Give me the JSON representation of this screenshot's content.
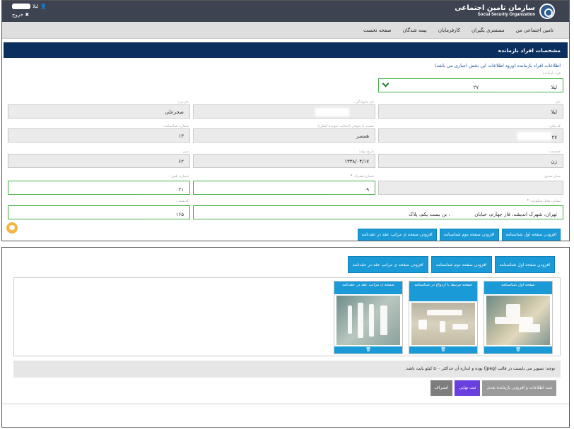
{
  "header": {
    "logo_fa": "سازمان تامین اجتماعی",
    "logo_en": "Social Security Organization",
    "user_name": "لیلا",
    "logout": "خروج",
    "user_icon": "user-icon",
    "logout_icon": "close-icon"
  },
  "menu": {
    "items": [
      "صفحه نخست",
      "بیمه شدگان",
      "کارفرمایان",
      "مستمری بگیران",
      "تامین اجتماعی من"
    ]
  },
  "section": {
    "title": "مشخصات افراد بازمانده",
    "info": "اطلاعات افراد بازمانده (ورود اطلاعات این بخش اجباری می باشد)"
  },
  "form": {
    "person_label": "فرد بازمانده",
    "person_value_name": "لیلا",
    "person_value_code": "۲۷",
    "first_name_label": "نام:",
    "first_name": "لیلا",
    "last_name_label": "نام خانوادگی:",
    "father_label": "نام پدر:",
    "father": "صحرعلی",
    "national_code_label": "کد ملی:",
    "national_code": "۲۷",
    "relation_label": "نسبت با متوفی (حمایت شونده اصلی):",
    "relation": "همسر",
    "id_number_label": "شماره شناسنامه:",
    "id_number": "۱۳",
    "gender_label": "جنسیت:",
    "gender": "زن",
    "birth_date_label": "تاریخ تولد:",
    "birth_date": "۱۳۳۸/۰۴/۱۷",
    "age_label": "سن:",
    "age": "۶۲",
    "workplace_label": "محل صدور:",
    "mobile_label": "شماره همراه:",
    "mobile": "۰۹",
    "phone_label": "شماره تلفن:",
    "phone": "۰۲۱",
    "address_label": "نشانی محل سکونت:",
    "address": "تهران، شهرک اندیشه، فاز چهارم، خیابان",
    "address_tail": "، بن بست یکم، پلاک",
    "postal_label": "کدپستی:",
    "postal": "۱۶۵"
  },
  "upload_buttons": [
    "افزودن صفحه اول شناسنامه",
    "افزودن صفحه دوم شناسنامه",
    "افزودن صفحه ی مراتب عقد در عقدنامه"
  ],
  "cards": [
    {
      "title": "صفحه اول شناسنامه",
      "delete_icon": "trash-icon"
    },
    {
      "title": "صفحه مرتبط با ازدواج در شناسنامه",
      "delete_icon": "trash-icon"
    },
    {
      "title": "صفحه ی مراتب عقد در عقدنامه",
      "delete_icon": "trash-icon"
    }
  ],
  "note": "توجه: تصویر می بایست در قالب (jpeg) بوده و اندازه آن حداکثر ۵۰۰ کیلو بایت باشد.",
  "actions": {
    "save_next": "ثبت اطلاعات و افزودن بازمانده بعدی",
    "final": "ثبت نهایی",
    "cancel": "انصراف"
  },
  "colors": {
    "header": "#3d4350",
    "section_bar": "#0b3060",
    "button_blue": "#1a9ad6",
    "button_purple": "#6a3fe0",
    "required_green": "#3fae46"
  }
}
